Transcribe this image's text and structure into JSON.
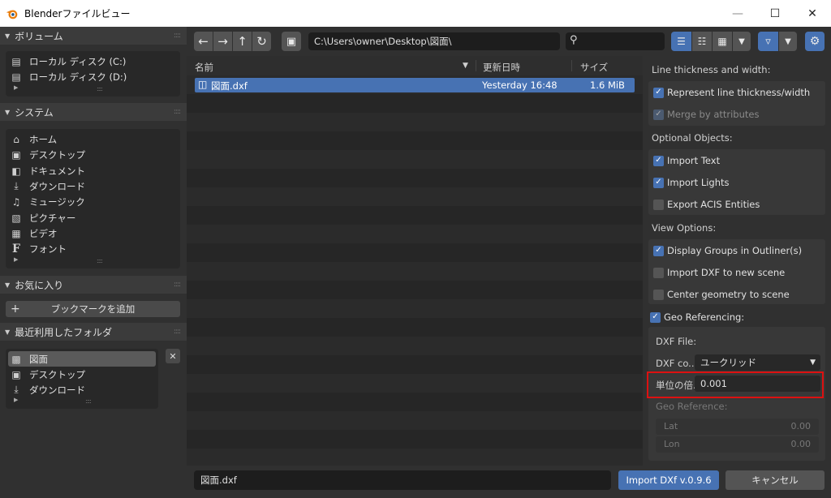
{
  "window": {
    "title": "Blenderファイルビュー",
    "minimize_icon": "minimize-icon",
    "maximize_icon": "maximize-icon",
    "close_icon": "close-icon"
  },
  "sidebar": {
    "volumes": {
      "title": "ボリューム",
      "items": [
        {
          "label": "ローカル ディスク (C:)",
          "icon": "disk-icon"
        },
        {
          "label": "ローカル ディスク (D:)",
          "icon": "disk-icon"
        }
      ]
    },
    "system": {
      "title": "システム",
      "items": [
        {
          "label": "ホーム",
          "icon": "home-icon"
        },
        {
          "label": "デスクトップ",
          "icon": "desktop-icon"
        },
        {
          "label": "ドキュメント",
          "icon": "documents-icon"
        },
        {
          "label": "ダウンロード",
          "icon": "download-icon"
        },
        {
          "label": "ミュージック",
          "icon": "music-icon"
        },
        {
          "label": "ピクチャー",
          "icon": "picture-icon"
        },
        {
          "label": "ビデオ",
          "icon": "video-icon"
        },
        {
          "label": "フォント",
          "icon": "font-icon"
        }
      ]
    },
    "favorites": {
      "title": "お気に入り",
      "add_bookmark": "ブックマークを追加"
    },
    "recent": {
      "title": "最近利用したフォルダ",
      "items": [
        {
          "label": "図面",
          "icon": "folder-icon",
          "selected": true
        },
        {
          "label": "デスクトップ",
          "icon": "desktop-icon"
        },
        {
          "label": "ダウンロード",
          "icon": "download-icon"
        }
      ]
    }
  },
  "toolbar": {
    "path": "C:\\Users\\owner\\Desktop\\図面\\",
    "search_value": ""
  },
  "filelist": {
    "columns": {
      "name": "名前",
      "date": "更新日時",
      "size": "サイズ"
    },
    "files": [
      {
        "name": "図面.dxf",
        "date": "Yesterday 16:48",
        "size": "1.6 MiB",
        "selected": true
      }
    ]
  },
  "options": {
    "line_section": "Line thickness and width:",
    "represent_line": {
      "label": "Represent line thickness/width",
      "checked": true
    },
    "merge_attr": {
      "label": "Merge by attributes",
      "checked": true,
      "disabled": true
    },
    "optional_section": "Optional Objects:",
    "import_text": {
      "label": "Import Text",
      "checked": true
    },
    "import_lights": {
      "label": "Import Lights",
      "checked": true
    },
    "export_acis": {
      "label": "Export ACIS Entities",
      "checked": false
    },
    "view_section": "View Options:",
    "display_groups": {
      "label": "Display Groups in Outliner(s)",
      "checked": true
    },
    "import_new_scene": {
      "label": "Import DXF to new scene",
      "checked": false
    },
    "center_geometry": {
      "label": "Center geometry to scene",
      "checked": false
    },
    "geo_ref": {
      "label": "Geo Referencing:",
      "checked": true
    },
    "dxf_file_label": "DXF File:",
    "dxf_coord_label": "DXF co...",
    "dxf_coord_value": "ユークリッド",
    "unit_scale_label": "単位の倍...",
    "unit_scale_value": "0.001",
    "geo_reference_label": "Geo Reference:",
    "lat_label": "Lat",
    "lat_value": "0.00",
    "lon_label": "Lon",
    "lon_value": "0.00"
  },
  "bottom": {
    "filename": "図面.dxf",
    "import_label": "Import DXf v.0.9.6",
    "cancel_label": "キャンセル"
  },
  "colors": {
    "accent": "#4772b3",
    "highlight_border": "#dd1111"
  }
}
